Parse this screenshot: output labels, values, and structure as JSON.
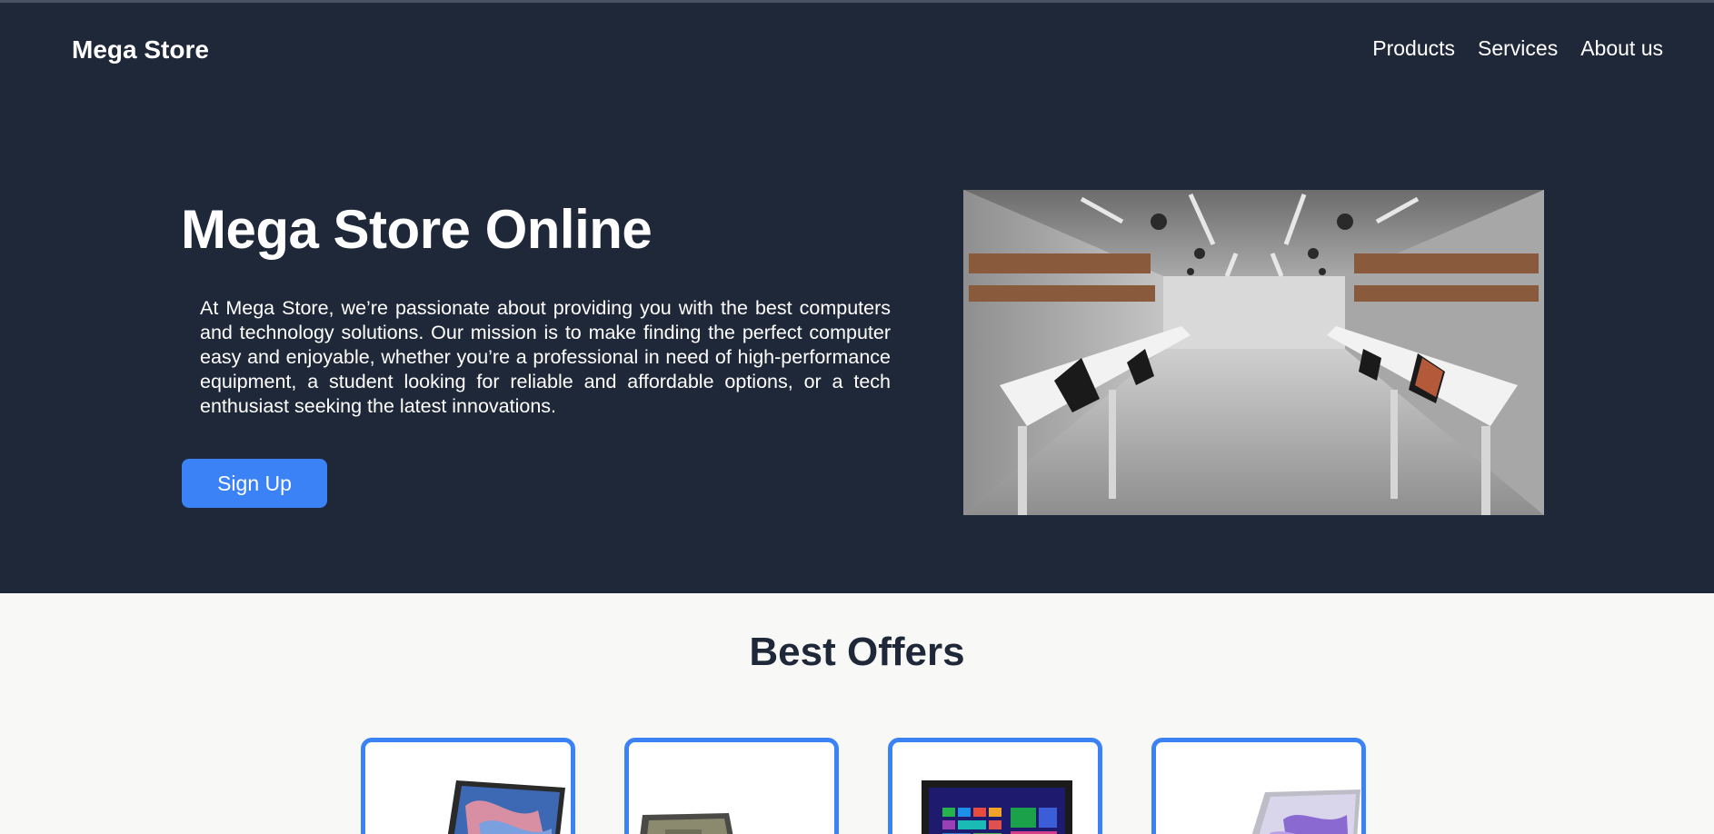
{
  "header": {
    "brand": "Mega Store",
    "nav": [
      "Products",
      "Services",
      "About us"
    ]
  },
  "hero": {
    "title": "Mega Store Online",
    "description": "At Mega Store, we’re passionate about providing you with the best computers and technology solutions. Our mission is to make finding the perfect computer easy and enjoyable, whether you’re a professional in need of high-performance equipment, a student looking for reliable and affordable options, or a tech enthusiast seeking the latest innovations.",
    "signup_label": "Sign Up",
    "image_alt": "computer store interior"
  },
  "offers": {
    "title": "Best Offers",
    "cards": [
      {
        "image": "laptop-blue-wallpaper"
      },
      {
        "image": "laptop-open-side"
      },
      {
        "image": "laptop-windows-tiles"
      },
      {
        "image": "laptop-purple-wallpaper"
      }
    ]
  },
  "colors": {
    "hero_bg": "#1f2839",
    "accent": "#3b82f6",
    "page_bg": "#f8f8f6"
  }
}
